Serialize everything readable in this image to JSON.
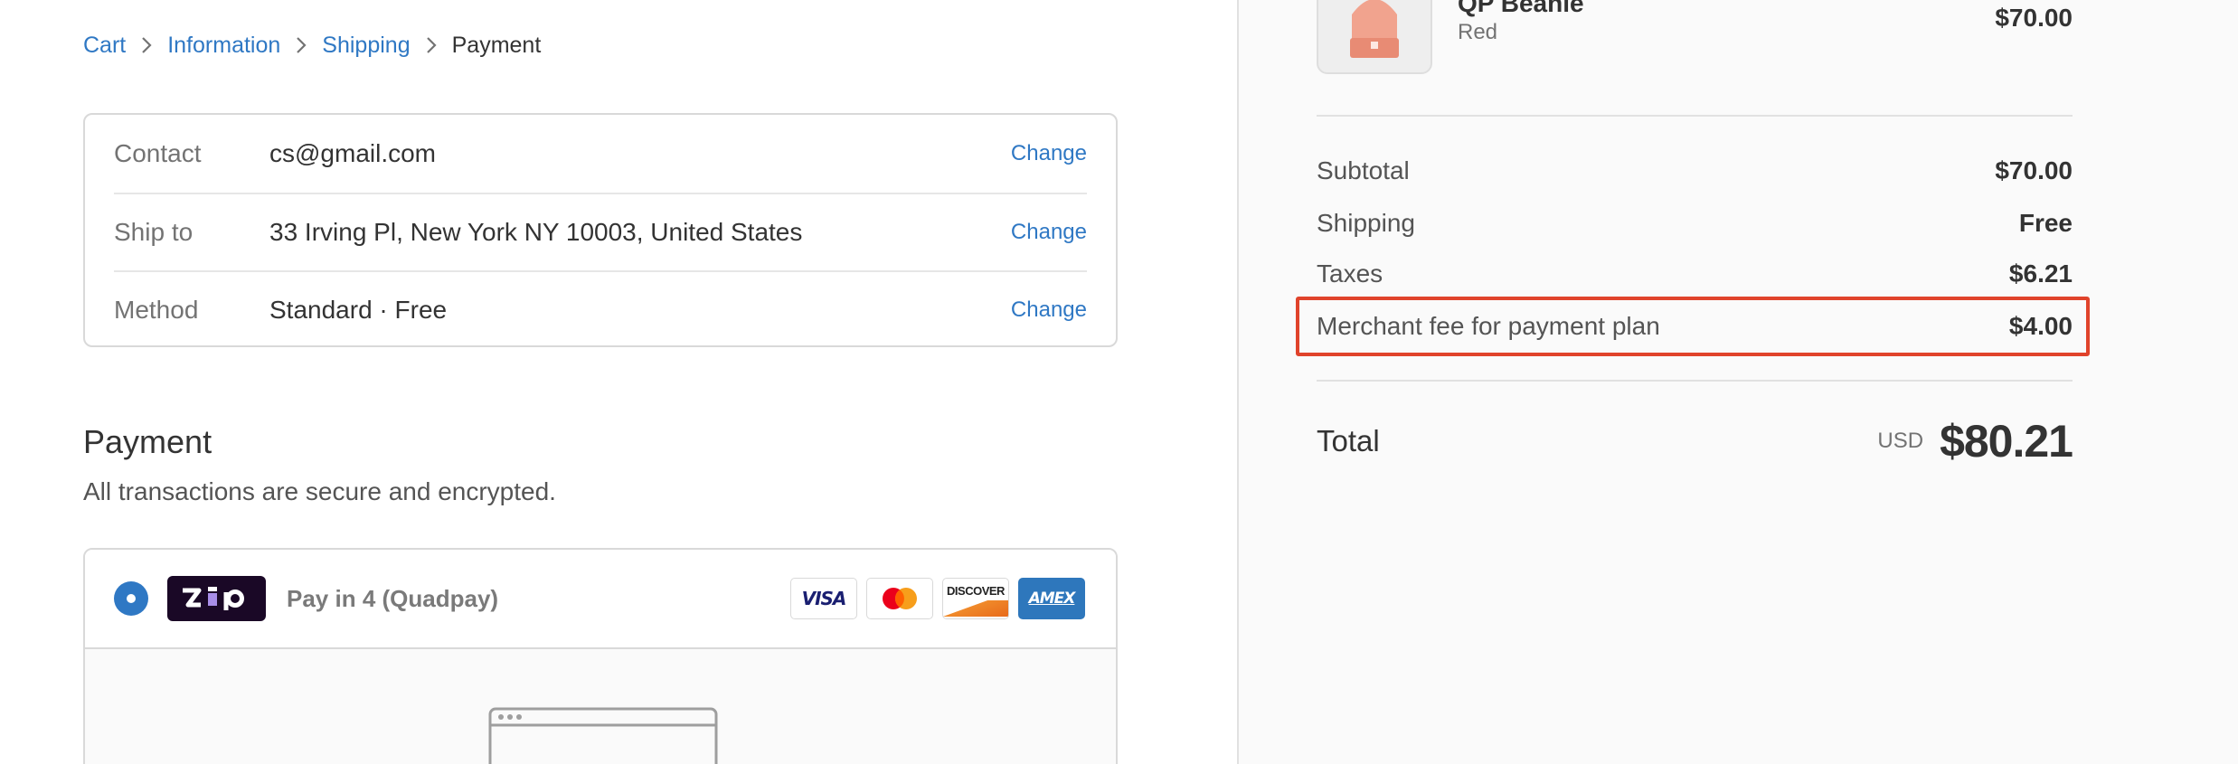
{
  "breadcrumb": {
    "items": [
      {
        "label": "Cart"
      },
      {
        "label": "Information"
      },
      {
        "label": "Shipping"
      },
      {
        "label": "Payment"
      }
    ]
  },
  "review": {
    "rows": [
      {
        "label": "Contact",
        "value": "cs@gmail.com",
        "action": "Change"
      },
      {
        "label": "Ship to",
        "value": "33 Irving Pl, New York NY 10003, United States",
        "action": "Change"
      },
      {
        "label": "Method",
        "value": "Standard · Free",
        "action": "Change"
      }
    ]
  },
  "payment": {
    "heading": "Payment",
    "subheading": "All transactions are secure and encrypted.",
    "option_label": "Pay in 4 (Quadpay)",
    "zip_logo_text": "zip",
    "cards": [
      "VISA",
      "Mastercard",
      "DISCOVER",
      "AMEX"
    ],
    "selected": true
  },
  "summary": {
    "product": {
      "name": "QP Beanie",
      "variant": "Red",
      "price": "$70.00"
    },
    "rows": [
      {
        "label": "Subtotal",
        "value": "$70.00"
      },
      {
        "label": "Shipping",
        "value": "Free"
      },
      {
        "label": "Taxes",
        "value": "$6.21"
      },
      {
        "label": "Merchant fee for payment plan",
        "value": "$4.00"
      }
    ],
    "total": {
      "label": "Total",
      "currency": "USD",
      "amount": "$80.21"
    }
  },
  "colors": {
    "link": "#2f78c4",
    "highlight": "#e0432b",
    "zip_brand": "#1a0826",
    "zip_accent": "#a98ee8"
  }
}
